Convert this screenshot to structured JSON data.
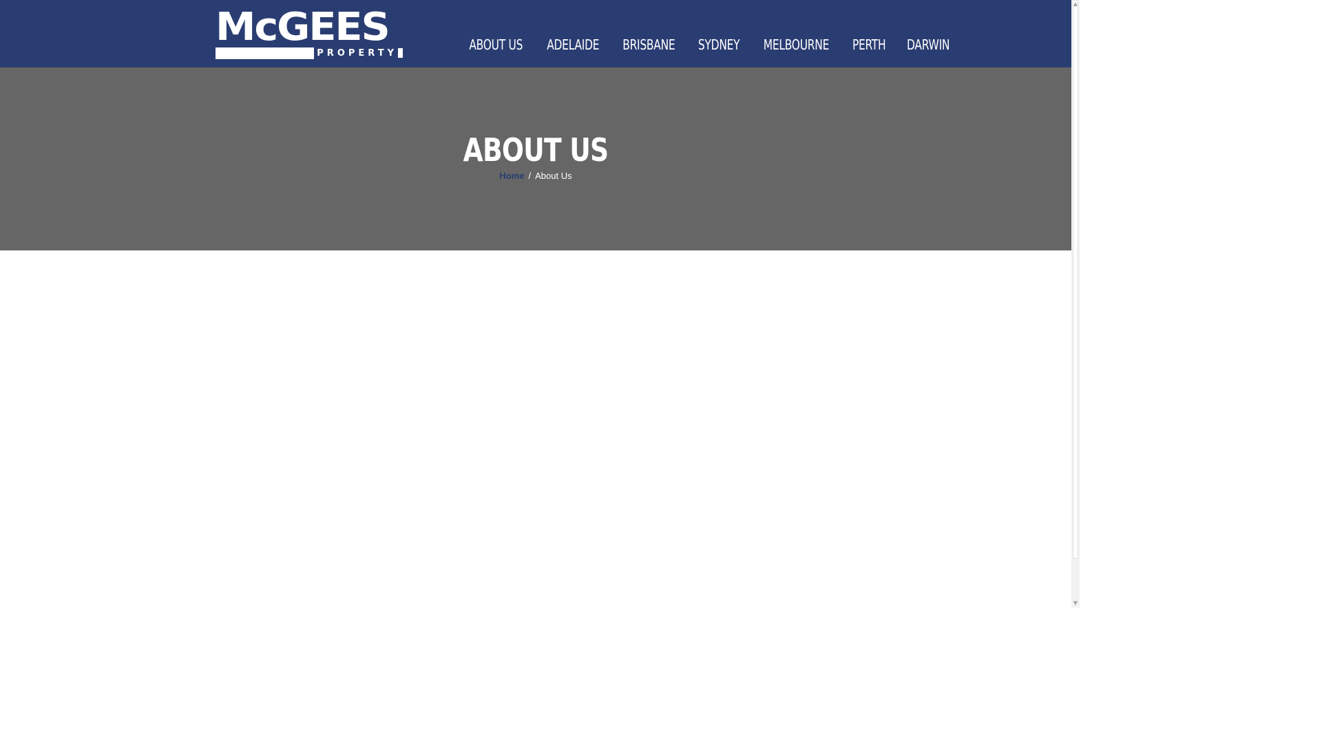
{
  "header": {
    "logo": {
      "main_text": "McGEES",
      "sub_text": "PROPERTY"
    },
    "nav": [
      {
        "label": "ABOUT US"
      },
      {
        "label": "ADELAIDE"
      },
      {
        "label": "BRISBANE"
      },
      {
        "label": "SYDNEY"
      },
      {
        "label": "MELBOURNE"
      },
      {
        "label": "PERTH"
      },
      {
        "label": "DARWIN"
      }
    ]
  },
  "hero": {
    "title": "ABOUT US",
    "breadcrumb": {
      "home": "Home",
      "separator": "/",
      "current": "About Us"
    }
  },
  "colors": {
    "header_bg": "#2a3d72",
    "hero_bg": "#666666",
    "text": "#ffffff"
  },
  "scrollbar": {
    "up_icon": "chevron-up-icon",
    "down_icon": "chevron-down-icon"
  }
}
